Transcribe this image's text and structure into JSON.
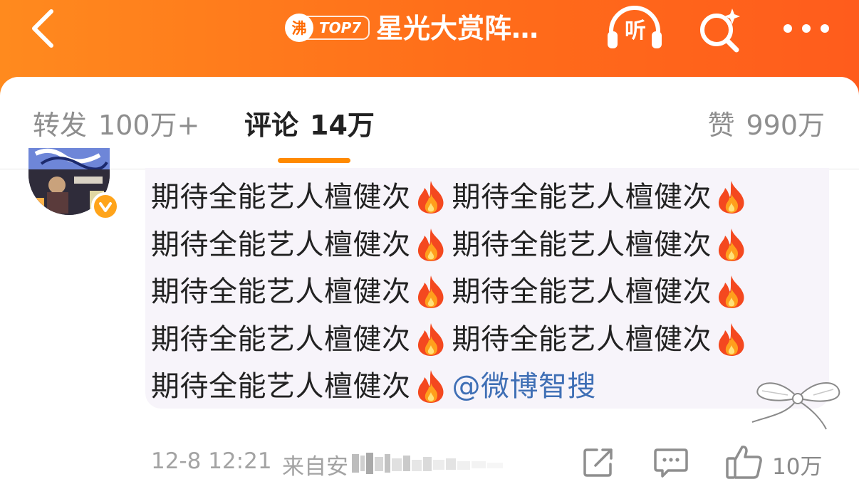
{
  "header": {
    "back_icon": "chevron-left-icon",
    "hot_badge_char": "沸",
    "hot_rank": "TOP7",
    "title": "星光大赏阵…",
    "listen_label": "听",
    "search_icon": "search-sparkle-icon",
    "more_icon": "more-dots-icon",
    "bar_color": "#ff6d1a"
  },
  "tabs": {
    "repost_label": "转发",
    "repost_count": "100万+",
    "comment_label": "评论",
    "comment_count": "14万",
    "like_label": "赞",
    "like_count": "990万",
    "active_color": "#ff8a00"
  },
  "comment": {
    "lines": [
      [
        "期待全能艺人檀健次",
        "期待全能艺人檀健次"
      ],
      [
        "期待全能艺人檀健次",
        "期待全能艺人檀健次"
      ],
      [
        "期待全能艺人檀健次",
        "期待全能艺人檀健次"
      ],
      [
        "期待全能艺人檀健次",
        "期待全能艺人檀健次"
      ]
    ],
    "last_line_text": "期待全能艺人檀健次",
    "mention": "@微博智搜",
    "emoji": "fire-emoji",
    "mention_color": "#3f6fb5",
    "verified_color": "#ffa41a"
  },
  "footer": {
    "time": "12-8 12:21",
    "source_prefix": "来自安",
    "like_count": "10万"
  }
}
